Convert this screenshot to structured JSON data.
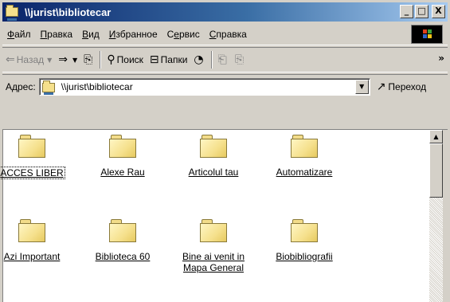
{
  "window": {
    "title": "\\\\jurist\\bibliotecar",
    "buttons": {
      "minimize": "_",
      "maximize": "□",
      "close": "X"
    }
  },
  "menu": {
    "items": [
      {
        "label": "Файл",
        "accel": "Ф",
        "rest": "айл"
      },
      {
        "label": "Правка",
        "accel": "П",
        "rest": "равка"
      },
      {
        "label": "Вид",
        "accel": "В",
        "rest": "ид"
      },
      {
        "label": "Избранное",
        "accel": "И",
        "rest": "збранное"
      },
      {
        "label": "Сервис",
        "pre": "С",
        "accel": "е",
        "rest": "рвис"
      },
      {
        "label": "Справка",
        "accel": "С",
        "rest": "правка"
      }
    ]
  },
  "toolbar": {
    "back_label": "Назад",
    "search_label": "Поиск",
    "folders_label": "Папки",
    "more": "»"
  },
  "address": {
    "label": "Адрес:",
    "value": "\\\\jurist\\bibliotecar",
    "go_label": "Переход"
  },
  "folders": [
    {
      "name": "ACCES LIBER",
      "selected": true
    },
    {
      "name": "Alexe Rau",
      "selected": false
    },
    {
      "name": "Articolul tau",
      "selected": false
    },
    {
      "name": "Automatizare",
      "selected": false
    },
    {
      "name": "Azi Important",
      "selected": false
    },
    {
      "name": "Biblioteca 60",
      "selected": false
    },
    {
      "name_line1": "Bine ai venit in",
      "name_line2": "Mapa General",
      "selected": false
    },
    {
      "name": "Biobibliografii",
      "selected": false
    }
  ],
  "colors": {
    "title_gradient_start": "#0a246a",
    "title_gradient_end": "#a6caf0",
    "chrome": "#d4d0c8",
    "folder_fill": "#f5e08c"
  }
}
